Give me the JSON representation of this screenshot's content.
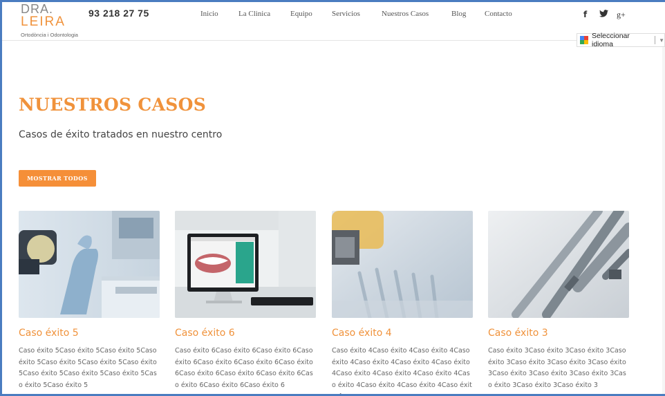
{
  "logo": {
    "line1": "DRA.",
    "line2": "LEIRA",
    "tagline": "Ortodòncia i Odontologia"
  },
  "header": {
    "phone": "93 218 27 75"
  },
  "nav": [
    "Inicio",
    "La Clinica",
    "Equipo",
    "Servicios",
    "Nuestros Casos",
    "Blog",
    "Contacto"
  ],
  "social": {
    "facebook": "f",
    "twitter": "🐦",
    "googleplus": "g+"
  },
  "language": {
    "label": "Seleccionar idioma",
    "arrow": "▼"
  },
  "hero": {
    "title": "NUESTROS CASOS",
    "subtitle": "Casos de éxito tratados en nuestro centro",
    "button": "MOSTRAR TODOS"
  },
  "cases": [
    {
      "title": "Caso éxito 5",
      "text": "Caso éxito 5Caso éxito 5Caso éxito 5Caso éxito 5Caso éxito 5Caso éxito 5Caso éxito 5Caso éxito 5Caso éxito 5Caso éxito 5Caso éxito 5Caso éxito 5"
    },
    {
      "title": "Caso éxito 6",
      "text": "Caso éxito 6Caso éxito 6Caso éxito 6Caso éxito 6Caso éxito 6Caso éxito 6Caso éxito 6Caso éxito 6Caso éxito 6Caso éxito 6Caso éxito 6Caso éxito 6Caso éxito 6"
    },
    {
      "title": "Caso éxito 4",
      "text": "Caso éxito 4Caso éxito 4Caso éxito 4Caso éxito 4Caso éxito 4Caso éxito 4Caso éxito 4Caso éxito 4Caso éxito 4Caso éxito 4Caso éxito 4Caso éxito 4Caso éxito 4Caso éxito 4"
    },
    {
      "title": "Caso éxito 3",
      "text": "Caso éxito 3Caso éxito 3Caso éxito 3Caso éxito 3Caso éxito 3Caso éxito 3Caso éxito 3Caso éxito 3Caso éxito 3Caso éxito 3Caso éxito 3Caso éxito 3Caso éxito 3"
    }
  ],
  "colors": {
    "accent": "#f0923b",
    "button": "#f58f38",
    "frame": "#4a7cc0"
  }
}
